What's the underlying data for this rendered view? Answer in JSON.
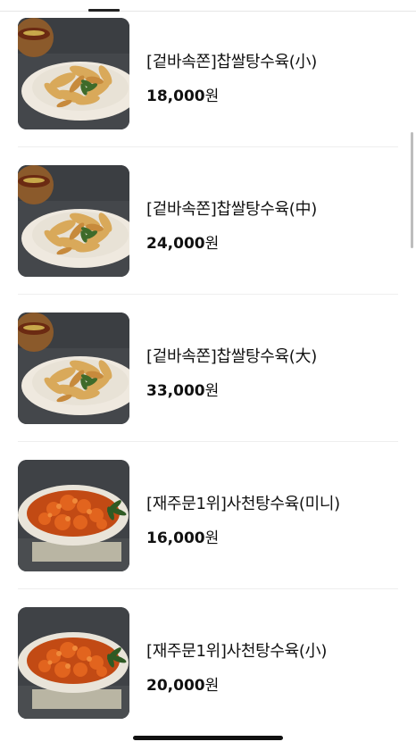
{
  "menu": {
    "items": [
      {
        "name": "[겉바속쫀]찹쌀탕수육(小)",
        "price": "18,000",
        "unit": "원",
        "image": "tangsuyuk-crispy-photo"
      },
      {
        "name": "[겉바속쫀]찹쌀탕수육(中)",
        "price": "24,000",
        "unit": "원",
        "image": "tangsuyuk-crispy-photo"
      },
      {
        "name": "[겉바속쫀]찹쌀탕수육(大)",
        "price": "33,000",
        "unit": "원",
        "image": "tangsuyuk-crispy-photo"
      },
      {
        "name": "[재주문1위]사천탕수육(미니)",
        "price": "16,000",
        "unit": "원",
        "image": "sichuan-tangsuyuk-photo"
      },
      {
        "name": "[재주문1위]사천탕수육(小)",
        "price": "20,000",
        "unit": "원",
        "image": "sichuan-tangsuyuk-photo"
      }
    ]
  }
}
